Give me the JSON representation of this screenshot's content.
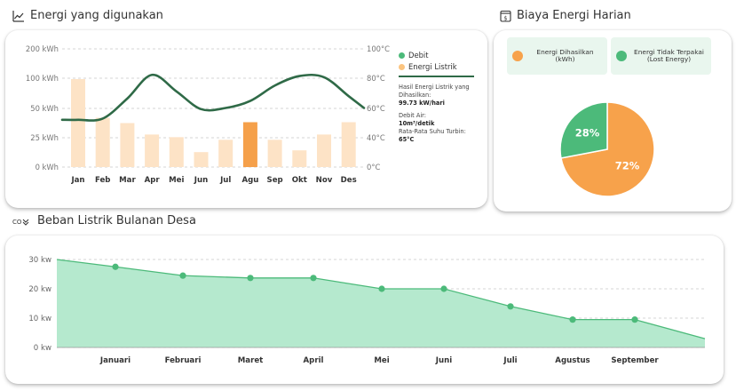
{
  "energi": {
    "title": "Energi yang digunakan",
    "legend": {
      "debit": "Debit",
      "energi_listrik": "Energi Listrik"
    },
    "info": {
      "hasil_label": "Hasil Energi Listrik yang Dihasilkan:",
      "hasil_value": "99.73 kW/hari",
      "debit_label": "Debit Air:",
      "debit_value": "10m³/detik",
      "suhu_label": "Rata-Rata Suhu Turbin:",
      "suhu_value": "65°C"
    }
  },
  "biaya": {
    "title": "Biaya Energi Harian",
    "legend": {
      "dihasilkan": "Energi Dihasilkan (kWh)",
      "tidak_terpakai": "Energi Tidak Terpakai (Lost Energy)"
    }
  },
  "beban": {
    "title": "Beban Listrik  Bulanan Desa"
  },
  "chart_data": [
    {
      "type": "bar",
      "categories": [
        "Jan",
        "Feb",
        "Mar",
        "Apr",
        "Mei",
        "Jun",
        "Jul",
        "Agu",
        "Sep",
        "Okt",
        "Nov",
        "Des"
      ],
      "series": [
        {
          "name": "Energi Listrik",
          "values": [
            100,
            56,
            50,
            37,
            34,
            17,
            31,
            51,
            31,
            19,
            37,
            51
          ]
        },
        {
          "name": "Debit",
          "type": "line",
          "axis": "right",
          "values": [
            40,
            41,
            58,
            78,
            64,
            49,
            50,
            56,
            69,
            77,
            76,
            60
          ]
        }
      ],
      "highlight_index": 7,
      "yticks_left": [
        "0 kWh",
        "25 kWh",
        "50 kWh",
        "100 kWh",
        "200 kWh"
      ],
      "yticks_right": [
        "0°C",
        "20°C",
        "40°C",
        "60°C",
        "80°C",
        "100°C"
      ],
      "ylim_left": [
        0,
        100
      ],
      "ylim_right": [
        0,
        100
      ],
      "grid": true,
      "colors": {
        "bar": "#fde3c6",
        "bar_highlight": "#f5a04a",
        "line": "#2f6a47"
      }
    },
    {
      "type": "pie",
      "labels": [
        "Energi Dihasilkan (kWh)",
        "Energi Tidak Terpakai (Lost Energy)"
      ],
      "values": [
        72,
        28
      ],
      "value_labels": [
        "72%",
        "28%"
      ],
      "colors": [
        "#f7a24b",
        "#4cba7a"
      ]
    },
    {
      "type": "area",
      "categories": [
        "Januari",
        "Februari",
        "Maret",
        "April",
        "Mei",
        "Juni",
        "Juli",
        "Agustus",
        "September"
      ],
      "values": [
        27.5,
        24.5,
        23.7,
        23.7,
        20,
        20,
        14,
        9.5,
        9.5
      ],
      "start_value": 30,
      "end_value": 3,
      "yticks": [
        "0 kw",
        "10 kw",
        "20 kw",
        "30 kw"
      ],
      "ylim": [
        0,
        30
      ],
      "grid": true,
      "colors": {
        "fill": "#b5e9ce",
        "line": "#4cba7a",
        "point": "#4cba7a"
      }
    }
  ]
}
